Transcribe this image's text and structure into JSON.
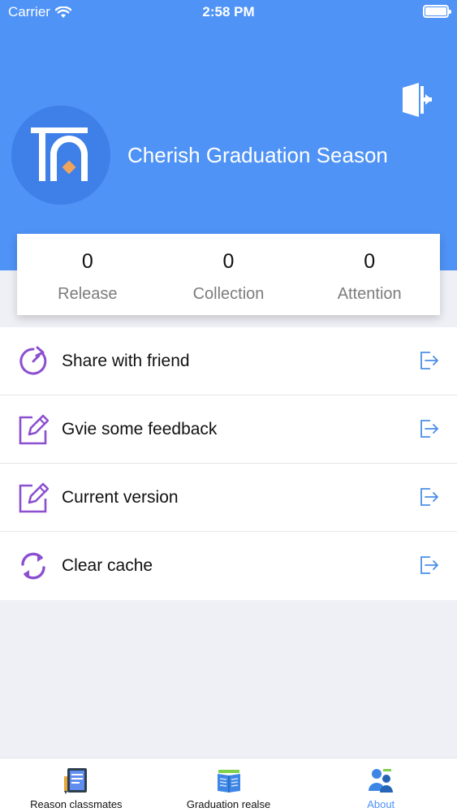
{
  "status_bar": {
    "carrier": "Carrier",
    "time": "2:58 PM"
  },
  "profile": {
    "name": "Cherish Graduation Season",
    "avatar_icon": "tn-logo-icon",
    "exit_icon": "exit-door-icon"
  },
  "stats": [
    {
      "value": "0",
      "label": "Release"
    },
    {
      "value": "0",
      "label": "Collection"
    },
    {
      "value": "0",
      "label": "Attention"
    }
  ],
  "menu": [
    {
      "label": "Share with friend",
      "icon": "share-refresh-icon"
    },
    {
      "label": "Gvie some feedback",
      "icon": "edit-icon"
    },
    {
      "label": "Current version",
      "icon": "edit-icon"
    },
    {
      "label": "Clear cache",
      "icon": "sync-icon"
    }
  ],
  "tabs": [
    {
      "label": "Reason classmates",
      "icon": "notebook-icon",
      "active": false
    },
    {
      "label": "Graduation realse",
      "icon": "open-book-icon",
      "active": false
    },
    {
      "label": "About",
      "icon": "user-group-icon",
      "active": true
    }
  ],
  "colors": {
    "header": "#4f93f6",
    "accent_purple": "#8b4fd0",
    "arrow_blue": "#4a8ee8",
    "background": "#efeff6"
  }
}
